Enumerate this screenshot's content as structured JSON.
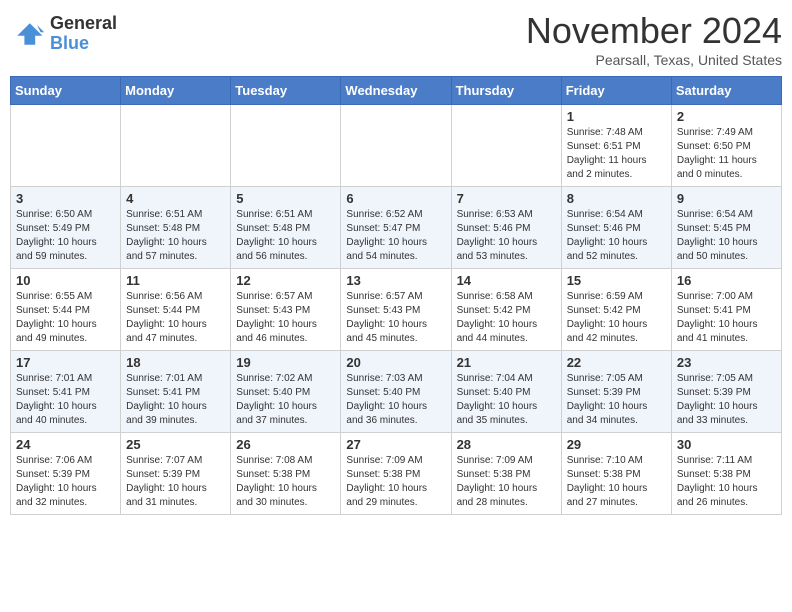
{
  "logo": {
    "general": "General",
    "blue": "Blue"
  },
  "header": {
    "month": "November 2024",
    "location": "Pearsall, Texas, United States"
  },
  "weekdays": [
    "Sunday",
    "Monday",
    "Tuesday",
    "Wednesday",
    "Thursday",
    "Friday",
    "Saturday"
  ],
  "weeks": [
    [
      {
        "day": "",
        "info": ""
      },
      {
        "day": "",
        "info": ""
      },
      {
        "day": "",
        "info": ""
      },
      {
        "day": "",
        "info": ""
      },
      {
        "day": "",
        "info": ""
      },
      {
        "day": "1",
        "info": "Sunrise: 7:48 AM\nSunset: 6:51 PM\nDaylight: 11 hours\nand 2 minutes."
      },
      {
        "day": "2",
        "info": "Sunrise: 7:49 AM\nSunset: 6:50 PM\nDaylight: 11 hours\nand 0 minutes."
      }
    ],
    [
      {
        "day": "3",
        "info": "Sunrise: 6:50 AM\nSunset: 5:49 PM\nDaylight: 10 hours\nand 59 minutes."
      },
      {
        "day": "4",
        "info": "Sunrise: 6:51 AM\nSunset: 5:48 PM\nDaylight: 10 hours\nand 57 minutes."
      },
      {
        "day": "5",
        "info": "Sunrise: 6:51 AM\nSunset: 5:48 PM\nDaylight: 10 hours\nand 56 minutes."
      },
      {
        "day": "6",
        "info": "Sunrise: 6:52 AM\nSunset: 5:47 PM\nDaylight: 10 hours\nand 54 minutes."
      },
      {
        "day": "7",
        "info": "Sunrise: 6:53 AM\nSunset: 5:46 PM\nDaylight: 10 hours\nand 53 minutes."
      },
      {
        "day": "8",
        "info": "Sunrise: 6:54 AM\nSunset: 5:46 PM\nDaylight: 10 hours\nand 52 minutes."
      },
      {
        "day": "9",
        "info": "Sunrise: 6:54 AM\nSunset: 5:45 PM\nDaylight: 10 hours\nand 50 minutes."
      }
    ],
    [
      {
        "day": "10",
        "info": "Sunrise: 6:55 AM\nSunset: 5:44 PM\nDaylight: 10 hours\nand 49 minutes."
      },
      {
        "day": "11",
        "info": "Sunrise: 6:56 AM\nSunset: 5:44 PM\nDaylight: 10 hours\nand 47 minutes."
      },
      {
        "day": "12",
        "info": "Sunrise: 6:57 AM\nSunset: 5:43 PM\nDaylight: 10 hours\nand 46 minutes."
      },
      {
        "day": "13",
        "info": "Sunrise: 6:57 AM\nSunset: 5:43 PM\nDaylight: 10 hours\nand 45 minutes."
      },
      {
        "day": "14",
        "info": "Sunrise: 6:58 AM\nSunset: 5:42 PM\nDaylight: 10 hours\nand 44 minutes."
      },
      {
        "day": "15",
        "info": "Sunrise: 6:59 AM\nSunset: 5:42 PM\nDaylight: 10 hours\nand 42 minutes."
      },
      {
        "day": "16",
        "info": "Sunrise: 7:00 AM\nSunset: 5:41 PM\nDaylight: 10 hours\nand 41 minutes."
      }
    ],
    [
      {
        "day": "17",
        "info": "Sunrise: 7:01 AM\nSunset: 5:41 PM\nDaylight: 10 hours\nand 40 minutes."
      },
      {
        "day": "18",
        "info": "Sunrise: 7:01 AM\nSunset: 5:41 PM\nDaylight: 10 hours\nand 39 minutes."
      },
      {
        "day": "19",
        "info": "Sunrise: 7:02 AM\nSunset: 5:40 PM\nDaylight: 10 hours\nand 37 minutes."
      },
      {
        "day": "20",
        "info": "Sunrise: 7:03 AM\nSunset: 5:40 PM\nDaylight: 10 hours\nand 36 minutes."
      },
      {
        "day": "21",
        "info": "Sunrise: 7:04 AM\nSunset: 5:40 PM\nDaylight: 10 hours\nand 35 minutes."
      },
      {
        "day": "22",
        "info": "Sunrise: 7:05 AM\nSunset: 5:39 PM\nDaylight: 10 hours\nand 34 minutes."
      },
      {
        "day": "23",
        "info": "Sunrise: 7:05 AM\nSunset: 5:39 PM\nDaylight: 10 hours\nand 33 minutes."
      }
    ],
    [
      {
        "day": "24",
        "info": "Sunrise: 7:06 AM\nSunset: 5:39 PM\nDaylight: 10 hours\nand 32 minutes."
      },
      {
        "day": "25",
        "info": "Sunrise: 7:07 AM\nSunset: 5:39 PM\nDaylight: 10 hours\nand 31 minutes."
      },
      {
        "day": "26",
        "info": "Sunrise: 7:08 AM\nSunset: 5:38 PM\nDaylight: 10 hours\nand 30 minutes."
      },
      {
        "day": "27",
        "info": "Sunrise: 7:09 AM\nSunset: 5:38 PM\nDaylight: 10 hours\nand 29 minutes."
      },
      {
        "day": "28",
        "info": "Sunrise: 7:09 AM\nSunset: 5:38 PM\nDaylight: 10 hours\nand 28 minutes."
      },
      {
        "day": "29",
        "info": "Sunrise: 7:10 AM\nSunset: 5:38 PM\nDaylight: 10 hours\nand 27 minutes."
      },
      {
        "day": "30",
        "info": "Sunrise: 7:11 AM\nSunset: 5:38 PM\nDaylight: 10 hours\nand 26 minutes."
      }
    ]
  ]
}
